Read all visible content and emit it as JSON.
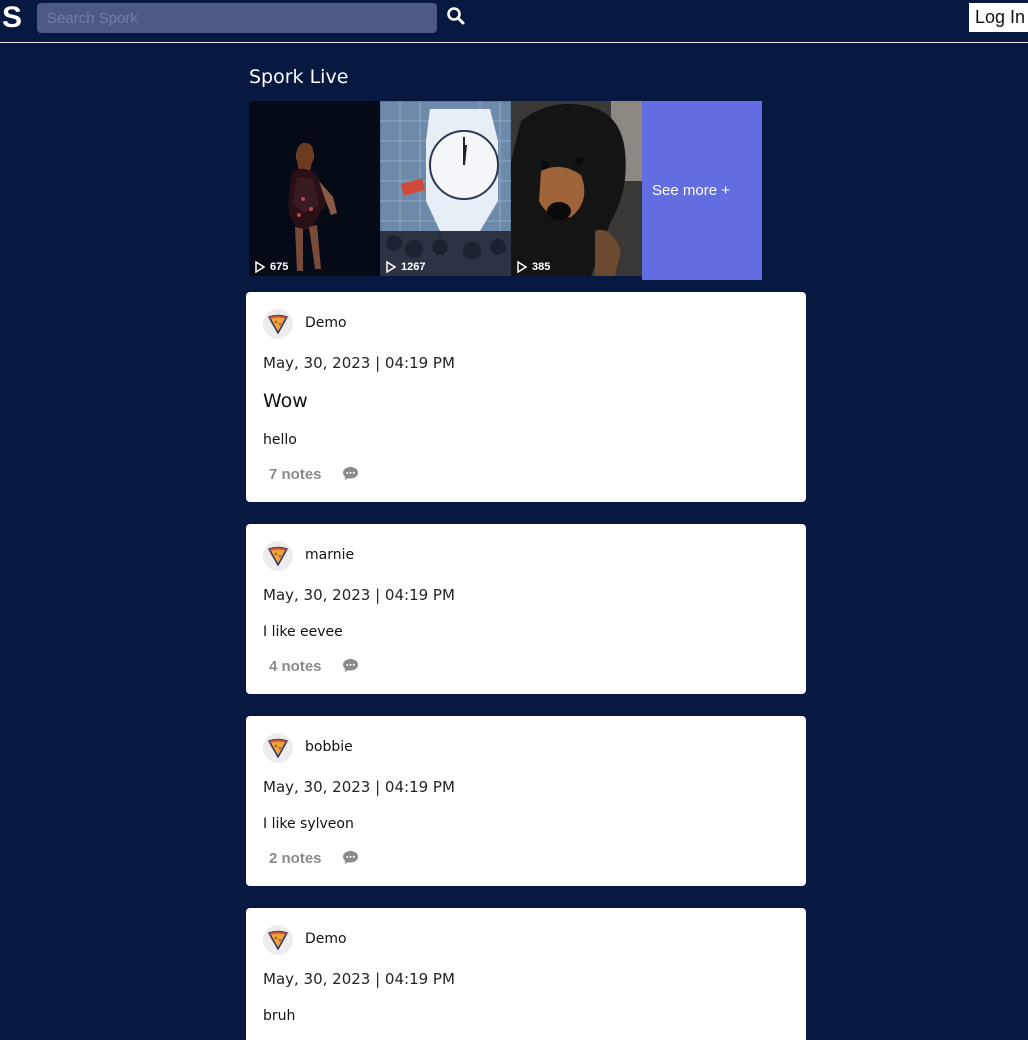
{
  "header": {
    "logo": "S",
    "search_placeholder": "Search Spork",
    "login_label": "Log In"
  },
  "live": {
    "title": "Spork Live",
    "videos": [
      {
        "views": "675",
        "subject": "singer performing on stage"
      },
      {
        "views": "1267",
        "subject": "large clock on tiled wall"
      },
      {
        "views": "385",
        "subject": "black and tan dog"
      }
    ],
    "see_more_label": "See more +"
  },
  "posts": [
    {
      "username": "Demo",
      "date": "May, 30, 2023 | 04:19 PM",
      "title": "Wow",
      "body": "hello",
      "notes": "7 notes"
    },
    {
      "username": "marnie",
      "date": "May, 30, 2023 | 04:19 PM",
      "title": "",
      "body": "I like eevee",
      "notes": "4 notes"
    },
    {
      "username": "bobbie",
      "date": "May, 30, 2023 | 04:19 PM",
      "title": "",
      "body": "I like sylveon",
      "notes": "2 notes"
    },
    {
      "username": "Demo",
      "date": "May, 30, 2023 | 04:19 PM",
      "title": "",
      "body": "bruh",
      "notes": ""
    }
  ],
  "colors": {
    "background": "#071941",
    "search_bg": "#4d5a83",
    "see_more_bg": "#616de0",
    "card_bg": "#ffffff",
    "muted": "#8a8a8a"
  },
  "icons": [
    "search-icon",
    "play-icon",
    "pizza-avatar-icon",
    "comment-icon"
  ]
}
